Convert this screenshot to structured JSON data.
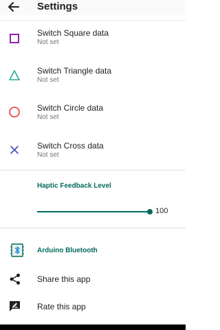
{
  "toolbar": {
    "title": "Settings"
  },
  "preferences": [
    {
      "title": "Switch Square data",
      "summary": "Not set",
      "icon": "square-icon",
      "color": "#8e24aa"
    },
    {
      "title": "Switch Triangle data",
      "summary": "Not set",
      "icon": "triangle-icon",
      "color": "#26a69a"
    },
    {
      "title": "Switch Circle data",
      "summary": "Not set",
      "icon": "circle-icon",
      "color": "#e53935"
    },
    {
      "title": "Switch Cross data",
      "summary": "Not set",
      "icon": "cross-icon",
      "color": "#3f51b5"
    }
  ],
  "haptic": {
    "title": "Haptic Feedback Level",
    "value": "100",
    "level_fraction": 1.0
  },
  "bluetooth": {
    "title": "Arduino Bluetooth",
    "icon": "bluetooth-icon"
  },
  "actions": [
    {
      "label": "Share this app",
      "icon": "share-icon"
    },
    {
      "label": "Rate this app",
      "icon": "rate-icon"
    }
  ],
  "colors": {
    "accent": "#00695c"
  }
}
